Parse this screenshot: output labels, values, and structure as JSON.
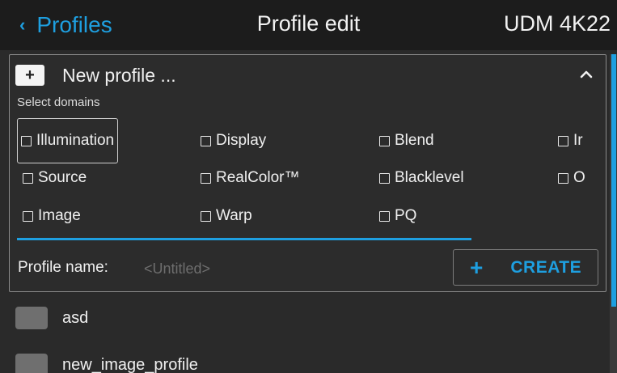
{
  "header": {
    "back_label": "Profiles",
    "title": "Profile edit",
    "device": "UDM 4K22"
  },
  "panel": {
    "add_symbol": "+",
    "new_profile_label": "New profile ...",
    "select_domains_label": "Select domains",
    "domains": [
      {
        "label": "Illumination",
        "checked": false,
        "focused": true
      },
      {
        "label": "Display",
        "checked": false
      },
      {
        "label": "Blend",
        "checked": false
      },
      {
        "label": "Ir",
        "checked": false
      },
      {
        "label": "Source",
        "checked": false
      },
      {
        "label": "RealColor™",
        "checked": false
      },
      {
        "label": "Blacklevel",
        "checked": false
      },
      {
        "label": "O",
        "checked": false
      },
      {
        "label": "Image",
        "checked": false
      },
      {
        "label": "Warp",
        "checked": false
      },
      {
        "label": "PQ",
        "checked": false
      }
    ],
    "profile_name_label": "Profile name:",
    "profile_name_value": "",
    "profile_name_placeholder": "<Untitled>",
    "create_symbol": "+",
    "create_label": "CREATE"
  },
  "profiles": [
    {
      "name": "asd"
    },
    {
      "name": "new_image_profile"
    }
  ],
  "colors": {
    "accent": "#1e9fe0",
    "header_bg": "#1c1c1c",
    "background": "#2a2a2a",
    "swatch": "#6f6f6f"
  },
  "icons": {
    "back": "chevron-left-icon",
    "add": "plus-icon",
    "collapse": "chevron-up-icon",
    "checkbox": "checkbox-unchecked-icon"
  }
}
